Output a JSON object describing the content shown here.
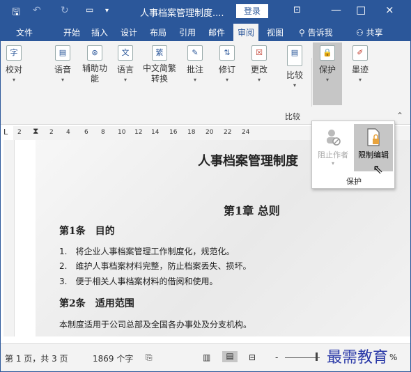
{
  "titlebar": {
    "quick_save_icon": "save-icon",
    "title": "人事档案管理制度....",
    "login_label": "登录",
    "ribbon_display_icon": "ribbon-display-icon",
    "minimize": "—",
    "restore": "□",
    "close": "×",
    "bg_color": "#2b579a"
  },
  "tabs": {
    "items": [
      "文件",
      "开始",
      "插入",
      "设计",
      "布局",
      "引用",
      "邮件",
      "审阅",
      "视图"
    ],
    "active": "审阅",
    "tell_me": "告诉我",
    "share": "共享"
  },
  "ribbon": {
    "proofing": "校对",
    "speech": "语音",
    "accessibility": "辅助功能",
    "language": "语言",
    "chinese_conversion": "中文简繁转换",
    "comments": "批注",
    "tracking": "修订",
    "changes": "更改",
    "compare": "比较",
    "protect": "保护",
    "ink": "墨迹",
    "compare_group": "比较"
  },
  "protect_menu": {
    "block_authors": "阻止作者",
    "restrict_editing": "限制编辑",
    "group_label": "保护"
  },
  "ruler": {
    "ticks": [
      "2",
      "2",
      "4",
      "6",
      "8",
      "10",
      "12",
      "14",
      "16",
      "18",
      "20",
      "22",
      "24"
    ],
    "tab_selector": "L"
  },
  "document": {
    "title": "人事档案管理制度",
    "chapter": "第1章 总则",
    "article1": "第1条　目的",
    "items": [
      "1.　将企业人事档案管理工作制度化，规范化。",
      "2.　维护人事档案材料完整，防止档案丢失、损坏。",
      "3.　便于相关人事档案材料的借阅和使用。"
    ],
    "article2": "第2条　适用范围",
    "scope": "本制度适用于公司总部及全国各办事处及分支机构。"
  },
  "status": {
    "page": "第 1 页，共 3 页",
    "words": "1869 个字",
    "zoom_minus": "-",
    "zoom_pct": "%"
  },
  "watermark": "最需教育"
}
